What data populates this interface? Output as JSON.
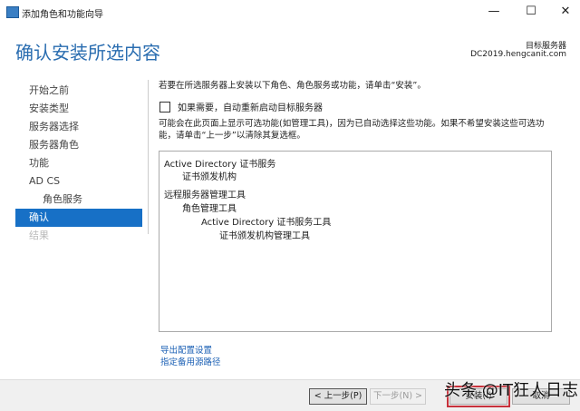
{
  "window": {
    "title": "添加角色和功能向导",
    "minimize": "—",
    "maximize": "☐",
    "close": "✕"
  },
  "header": {
    "title": "确认安装所选内容",
    "server_label": "目标服务器",
    "server_name": "DC2019.hengcanit.com"
  },
  "sidebar": {
    "items": [
      {
        "label": "开始之前"
      },
      {
        "label": "安装类型"
      },
      {
        "label": "服务器选择"
      },
      {
        "label": "服务器角色"
      },
      {
        "label": "功能"
      },
      {
        "label": "AD CS"
      },
      {
        "label": "角色服务"
      },
      {
        "label": "确认"
      },
      {
        "label": "结果"
      }
    ]
  },
  "main": {
    "intro": "若要在所选服务器上安装以下角色、角色服务或功能，请单击“安装”。",
    "restart_label": "如果需要，自动重新启动目标服务器",
    "restart_checked": false,
    "note": "可能会在此页面上显示可选功能(如管理工具)，因为已自动选择这些功能。如果不希望安装这些可选功能，请单击“上一步”以清除其复选框。",
    "items": [
      "Active Directory 证书服务",
      "证书颁发机构",
      "远程服务器管理工具",
      "角色管理工具",
      "Active Directory 证书服务工具",
      "证书颁发机构管理工具"
    ],
    "export_link": "导出配置设置",
    "alt_source_link": "指定备用源路径"
  },
  "footer": {
    "prev": "< 上一步(P)",
    "next": "下一步(N) >",
    "install": "安装(I)",
    "cancel": "取消"
  },
  "watermark": "头条 @IT狂人日志"
}
